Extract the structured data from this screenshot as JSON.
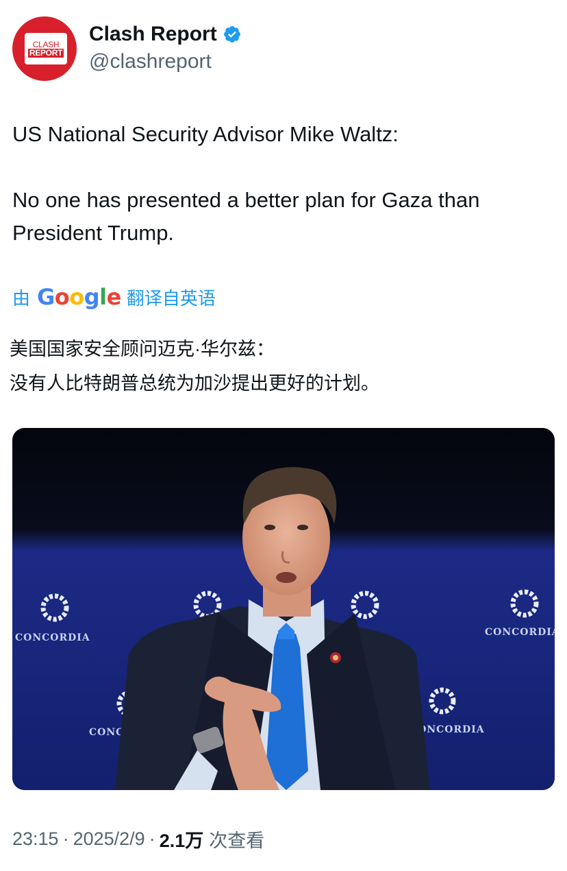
{
  "author": {
    "avatar_logo_top": "CLASH",
    "avatar_logo_bottom": "REPORT",
    "display_name": "Clash Report",
    "handle": "@clashreport"
  },
  "tweet": {
    "line1": "US National Security Advisor Mike Waltz:",
    "line2": "No one has presented a better plan for Gaza than President Trump."
  },
  "translation": {
    "prefix": "由",
    "brand": "Google",
    "suffix": "翻译自英语",
    "line1": "美国国家安全顾问迈克·华尔兹：",
    "line2": "没有人比特朗普总统为加沙提出更好的计划。"
  },
  "media": {
    "backdrop_text": "CONCORDIA"
  },
  "meta": {
    "time": "23:15",
    "date": "2025/2/9",
    "views_count": "2.1万",
    "views_label": "次查看"
  },
  "colors": {
    "accent": "#1d9bf0",
    "brand_red": "#d8202c",
    "secondary_text": "#536471"
  }
}
